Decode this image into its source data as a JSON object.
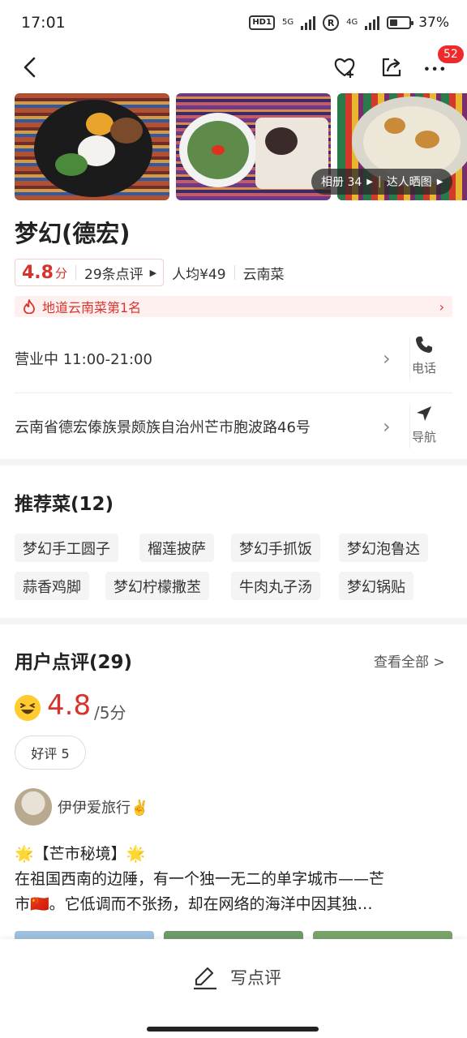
{
  "status_bar": {
    "time": "17:01",
    "hd": "HD1",
    "net1": "5G",
    "net2": "4G",
    "r": "R",
    "battery": "37%"
  },
  "nav": {
    "back_icon": "chevron-left-icon",
    "fav_icon": "heart-plus-icon",
    "share_icon": "share-icon",
    "more_icon": "more-dots-icon",
    "badge": "52"
  },
  "photos": {
    "album_label": "相册 34",
    "talent_label": "达人晒图"
  },
  "shop": {
    "name": "梦幻(德宏)",
    "rating": "4.8",
    "rating_unit": "分",
    "reviews_count": "29条点评",
    "avg_price": "人均¥49",
    "category": "云南菜",
    "rank": "地道云南菜第1名",
    "hours": "营业中 11:00-21:00",
    "address": "云南省德宏傣族景颇族自治州芒市胞波路46号",
    "phone_label": "电话",
    "nav_label": "导航"
  },
  "recommended": {
    "title": "推荐菜(12)",
    "dishes": [
      "梦幻手工圆子",
      "榴莲披萨",
      "梦幻手抓饭",
      "梦幻泡鲁达",
      "蒜香鸡脚",
      "梦幻柠檬撒苤",
      "牛肉丸子汤",
      "梦幻锅贴"
    ]
  },
  "reviews": {
    "title": "用户点评(29)",
    "see_all": "查看全部 >",
    "score": "4.8",
    "score_unit": "/5分",
    "good_tag": "好评 5",
    "user": "伊伊爱旅行✌️",
    "line1": "🌟【芒市秘境】🌟",
    "line2": "在祖国西南的边陲，有一个独一无二的单字城市——芒",
    "line3": "市🇨🇳。它低调而不张扬，却在网络的海洋中因其独…"
  },
  "bottom": {
    "write_label": "写点评"
  },
  "colors": {
    "accent": "#d8332b",
    "badge": "#ef2a2a",
    "tag_bg": "#f4f4f4",
    "rank_bg": "#fff0f0"
  }
}
